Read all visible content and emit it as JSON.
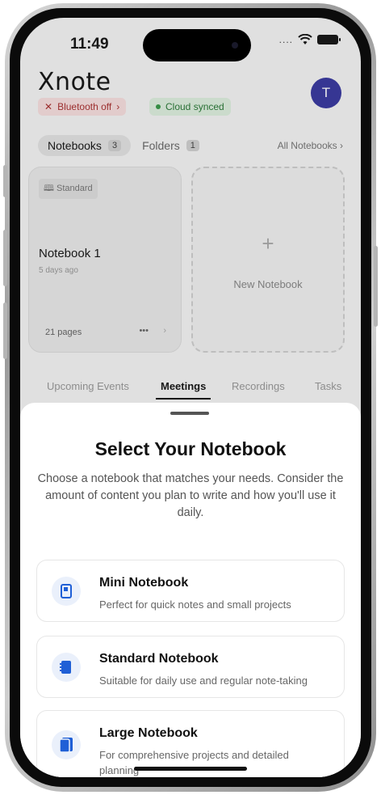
{
  "status_bar": {
    "time": "11:49",
    "signal": "....",
    "wifi_icon": "wifi-icon",
    "battery_icon": "battery-icon"
  },
  "app": {
    "logo": "Xnote",
    "avatar_initial": "T",
    "chips": {
      "bluetooth": "Bluetooth off",
      "cloud": "Cloud synced"
    },
    "tabs": {
      "notebooks_label": "Notebooks",
      "notebooks_count": "3",
      "folders_label": "Folders",
      "folders_count": "1",
      "all_notebooks": "All Notebooks"
    },
    "notebook_card": {
      "badge": "Standard",
      "title": "Notebook 1",
      "subtitle": "5 days ago",
      "pages": "21 pages",
      "more": "•••",
      "chevron": "›"
    },
    "new_card": {
      "plus": "+",
      "label": "New Notebook"
    },
    "section_tabs": [
      "Upcoming Events",
      "Meetings",
      "Recordings",
      "Tasks"
    ]
  },
  "sheet": {
    "title": "Select Your Notebook",
    "description": "Choose a notebook that matches your needs. Consider the amount of content you plan to write and how you'll use it daily.",
    "options": [
      {
        "title": "Mini Notebook",
        "subtitle": "Perfect for quick notes and small projects",
        "icon": "mini-notebook-icon"
      },
      {
        "title": "Standard Notebook",
        "subtitle": "Suitable for daily use and regular note-taking",
        "icon": "standard-notebook-icon"
      },
      {
        "title": "Large Notebook",
        "subtitle": "For comprehensive projects and detailed planning",
        "icon": "large-notebook-icon"
      }
    ]
  },
  "colors": {
    "accent": "#1f5fd6",
    "avatar": "#3b3ba0"
  }
}
